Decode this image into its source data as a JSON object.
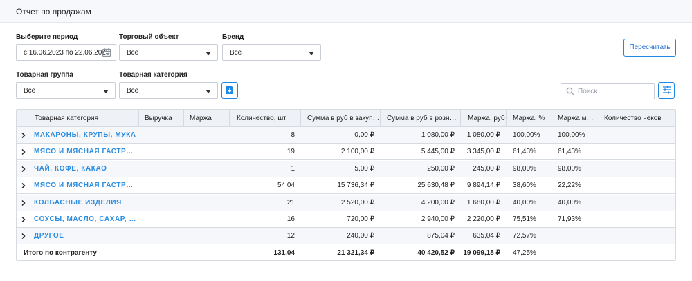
{
  "header": {
    "title": "Отчет по продажам"
  },
  "filters": {
    "period_label": "Выберите период",
    "period_value": "с 16.06.2023  по 22.06.2023",
    "outlet_label": "Торговый объект",
    "outlet_value": "Все",
    "brand_label": "Бренд",
    "brand_value": "Все",
    "group_label": "Товарная группа",
    "group_value": "Все",
    "category_label": "Товарная категория",
    "category_value": "Все"
  },
  "toolbar": {
    "recalc_label": "Пересчитать",
    "search_placeholder": "Поиск"
  },
  "table": {
    "columns": [
      "Товарная категория",
      "Выручка",
      "Маржа",
      "Количество, шт",
      "Сумма в руб в закупочн…",
      "Сумма в руб в рознични…",
      "Маржа, руб",
      "Маржа, %",
      "Маржа мин, …",
      "Количество чеков"
    ],
    "rows": [
      {
        "name": "МАКАРОНЫ, КРУПЫ, МУКА",
        "qty": "8",
        "purchase": "0,00 ₽",
        "retail": "1 080,00 ₽",
        "margin_rub": "1 080,00 ₽",
        "margin_pct": "100,00%",
        "margin_min": "100,00%"
      },
      {
        "name": "МЯСО И МЯСНАЯ ГАСТРОНО…",
        "qty": "19",
        "purchase": "2 100,00 ₽",
        "retail": "5 445,00 ₽",
        "margin_rub": "3 345,00 ₽",
        "margin_pct": "61,43%",
        "margin_min": "61,43%"
      },
      {
        "name": "ЧАЙ, КОФЕ, КАКАО",
        "qty": "1",
        "purchase": "5,00 ₽",
        "retail": "250,00 ₽",
        "margin_rub": "245,00 ₽",
        "margin_pct": "98,00%",
        "margin_min": "98,00%"
      },
      {
        "name": "МЯСО И МЯСНАЯ ГАСТРОНО…",
        "qty": "54,04",
        "purchase": "15 736,34 ₽",
        "retail": "25 630,48 ₽",
        "margin_rub": "9 894,14 ₽",
        "margin_pct": "38,60%",
        "margin_min": "22,22%"
      },
      {
        "name": "КОЛБАСНЫЕ ИЗДЕЛИЯ",
        "qty": "21",
        "purchase": "2 520,00 ₽",
        "retail": "4 200,00 ₽",
        "margin_rub": "1 680,00 ₽",
        "margin_pct": "40,00%",
        "margin_min": "40,00%"
      },
      {
        "name": "СОУСЫ, МАСЛО, САХАР, СПЕ…",
        "qty": "16",
        "purchase": "720,00 ₽",
        "retail": "2 940,00 ₽",
        "margin_rub": "2 220,00 ₽",
        "margin_pct": "75,51%",
        "margin_min": "71,93%"
      },
      {
        "name": "ДРУГОЕ",
        "qty": "12",
        "purchase": "240,00 ₽",
        "retail": "875,04 ₽",
        "margin_rub": "635,04 ₽",
        "margin_pct": "72,57%",
        "margin_min": ""
      }
    ],
    "total": {
      "label": "Итого по контрагенту",
      "qty": "131,04",
      "purchase": "21 321,34 ₽",
      "retail": "40 420,52 ₽",
      "margin_rub": "19 099,18 ₽",
      "margin_pct": "47,25%"
    }
  },
  "icons": {
    "date": "calendar-icon",
    "export": "file-export-icon",
    "settings": "settings-sliders-icon",
    "search": "search-icon",
    "expand": "chevron-right-icon"
  },
  "colors": {
    "accent": "#1e88e5",
    "link": "#2b8de0",
    "header_bg": "#eef1f6"
  }
}
